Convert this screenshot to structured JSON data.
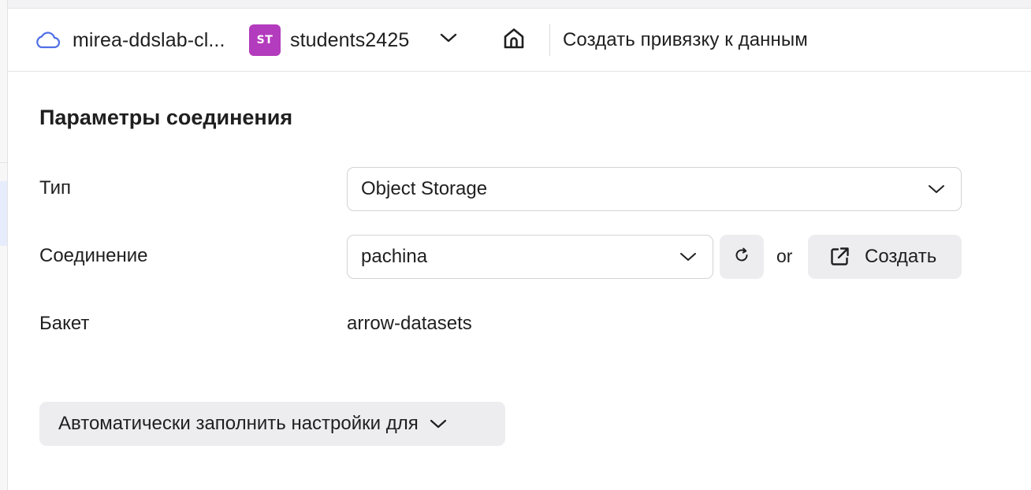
{
  "header": {
    "cloud_name": "mirea-ddslab-cl...",
    "cloud_icon": "cloud-icon",
    "folder_badge": "ST",
    "folder_badge_color": "#b33bbd",
    "folder_name": "students2425",
    "folder_switch_icon": "chevron-down-icon",
    "home_icon": "home-icon",
    "page_title": "Создать привязку к данным"
  },
  "form": {
    "section_title": "Параметры соединения",
    "type": {
      "label": "Тип",
      "value": "Object Storage"
    },
    "connection": {
      "label": "Соединение",
      "value": "pachina",
      "refresh_icon": "refresh-icon",
      "or_text": "or",
      "create_label": "Создать",
      "create_icon": "external-link-icon"
    },
    "bucket": {
      "label": "Бакет",
      "value": "arrow-datasets"
    },
    "autofill_label": "Автоматически заполнить настройки для"
  },
  "colors": {
    "accent": "#4f6fe6",
    "button_bg": "#ededf0",
    "border": "#d3d3d7"
  }
}
